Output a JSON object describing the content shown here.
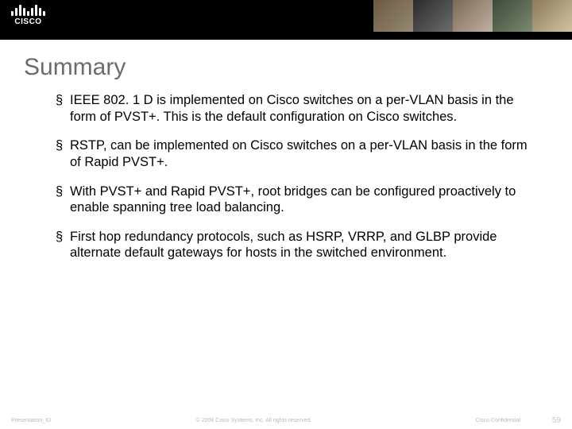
{
  "logo_text": "CISCO",
  "title": "Summary",
  "bullets": [
    "IEEE 802. 1 D is implemented on Cisco switches on a per-VLAN basis in the form of PVST+. This is the default configuration on Cisco switches.",
    "RSTP, can be implemented on Cisco switches on a per-VLAN basis in the form of Rapid PVST+.",
    "With PVST+ and Rapid PVST+, root bridges can be configured proactively to enable spanning tree load balancing.",
    "First hop redundancy protocols, such as HSRP, VRRP, and GLBP provide alternate default gateways for hosts in the switched environment."
  ],
  "footer": {
    "id": "Presentation_ID",
    "copyright": "© 2008 Cisco Systems, Inc. All rights reserved.",
    "confidential": "Cisco Confidential",
    "page": "59"
  }
}
